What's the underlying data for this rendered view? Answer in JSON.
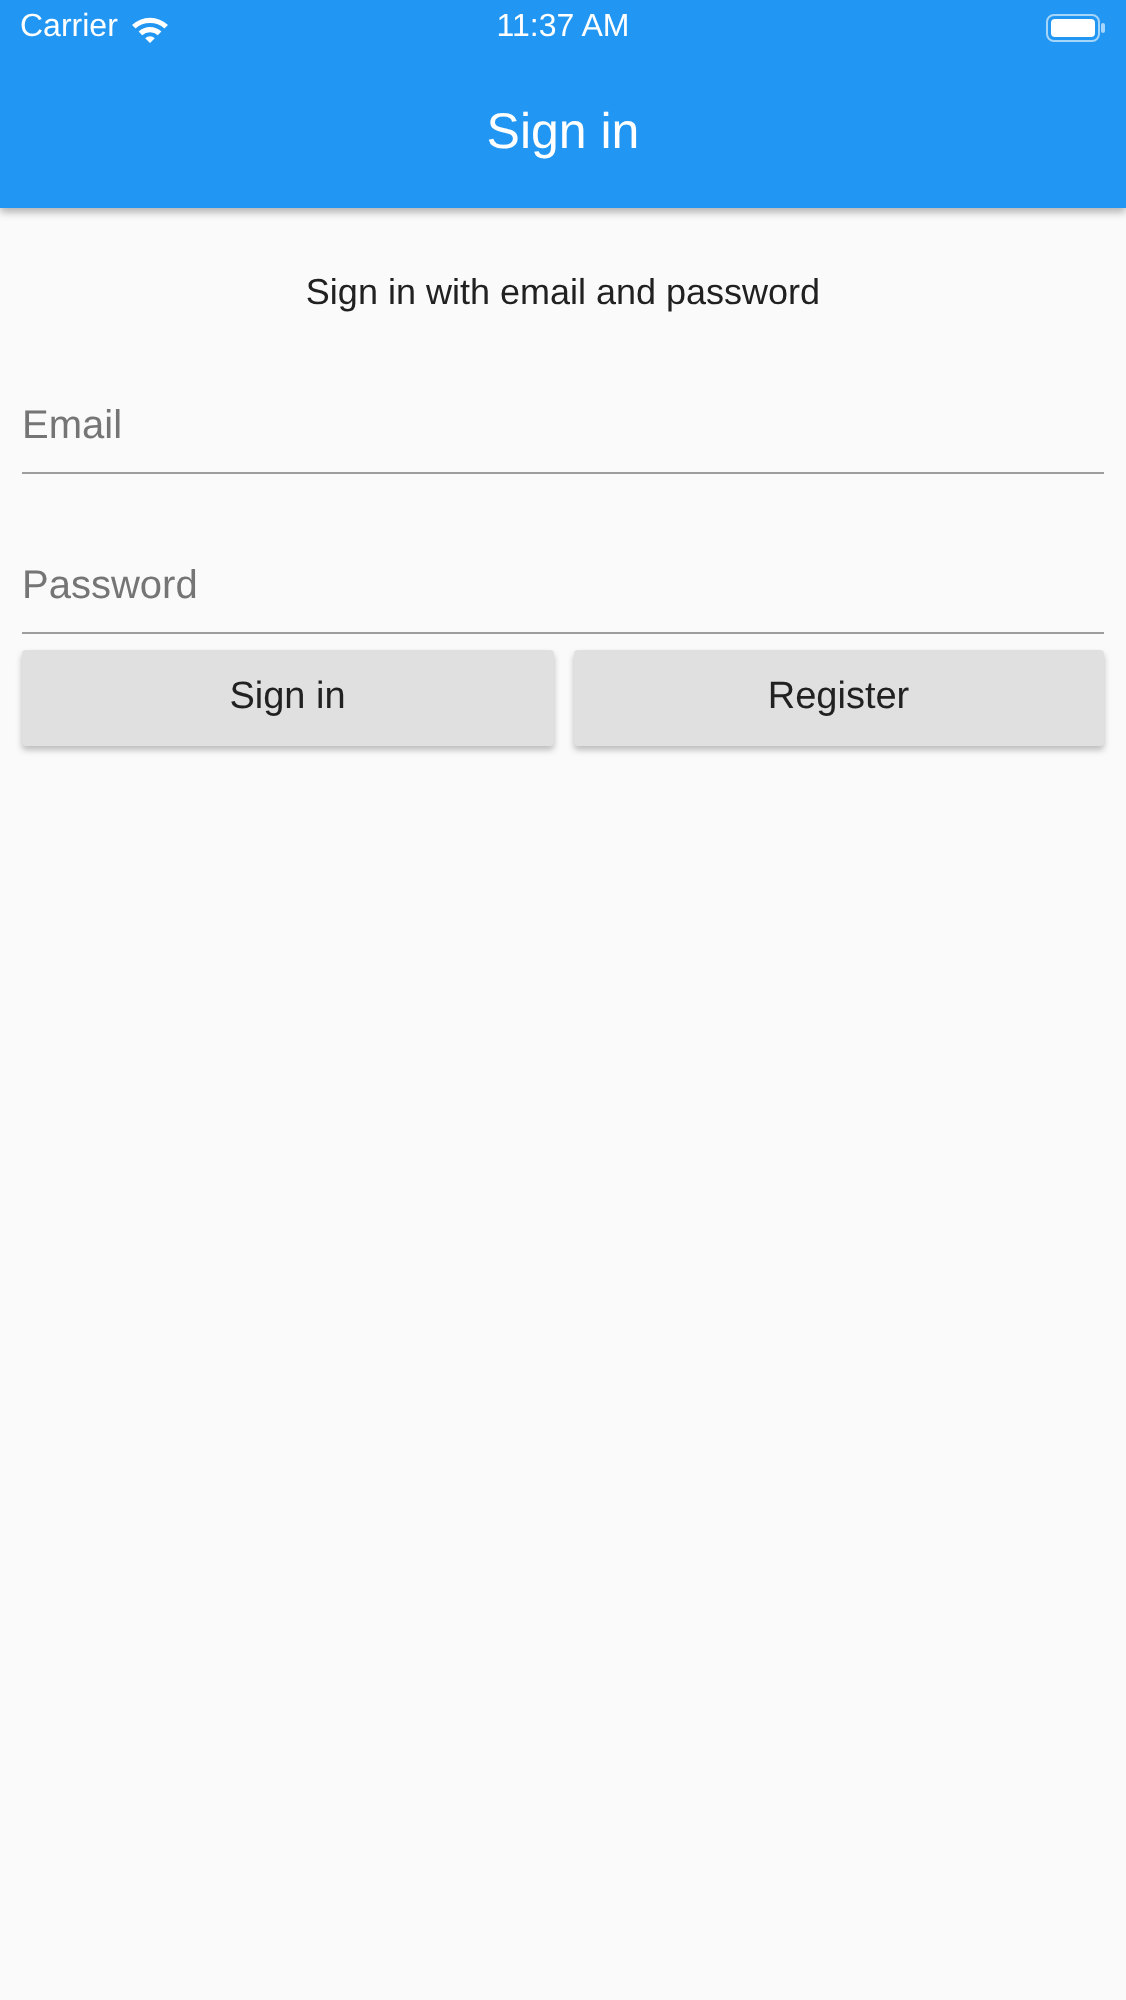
{
  "status_bar": {
    "carrier": "Carrier",
    "time": "11:37 AM"
  },
  "app_bar": {
    "title": "Sign in"
  },
  "form": {
    "subtitle": "Sign in with email and password",
    "fields": [
      {
        "placeholder": "Email"
      },
      {
        "placeholder": "Password"
      }
    ],
    "buttons": [
      "Sign in",
      "Register"
    ]
  }
}
